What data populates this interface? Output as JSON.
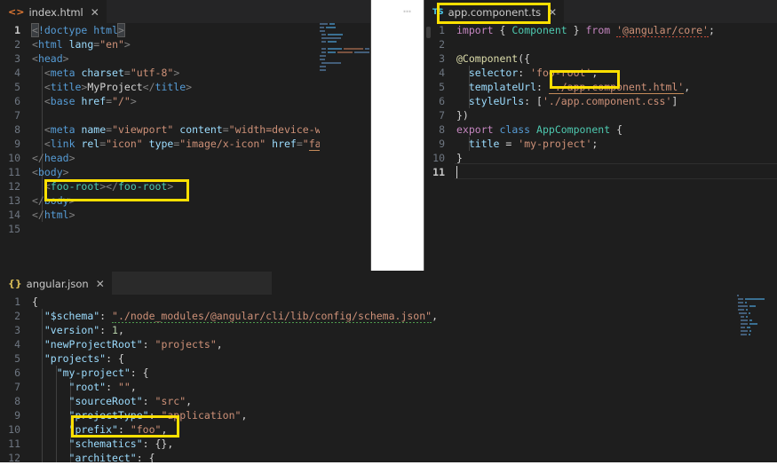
{
  "window": {
    "theme_bg": "#1e1e1e",
    "tabbar_bg": "#252526",
    "highlight_color": "#ffe000",
    "overflow_menu": "…"
  },
  "editors": [
    {
      "id": "left-editor",
      "tab": {
        "label": "index.html",
        "icon": "html-icon",
        "icon_glyph": "<>",
        "close_glyph": "✕",
        "icon_color": "#e37933"
      },
      "lines": [
        {
          "n": "1",
          "text": "<!doctype html>"
        },
        {
          "n": "2",
          "text": "<html lang=\"en\">"
        },
        {
          "n": "3",
          "text": "<head>"
        },
        {
          "n": "4",
          "text": "  <meta charset=\"utf-8\">"
        },
        {
          "n": "5",
          "text": "  <title>MyProject</title>"
        },
        {
          "n": "6",
          "text": "  <base href=\"/\">"
        },
        {
          "n": "7",
          "text": ""
        },
        {
          "n": "8",
          "text": "  <meta name=\"viewport\" content=\"width=device-width, initi"
        },
        {
          "n": "9",
          "text": "  <link rel=\"icon\" type=\"image/x-icon\" href=\"favicon.ico\">"
        },
        {
          "n": "10",
          "text": "</head>"
        },
        {
          "n": "11",
          "text": "<body>"
        },
        {
          "n": "12",
          "text": "  <foo-root></foo-root>"
        },
        {
          "n": "13",
          "text": "</body>"
        },
        {
          "n": "14",
          "text": "</html>"
        },
        {
          "n": "15",
          "text": ""
        }
      ],
      "highlighted_text": "<foo-root></foo-root>"
    },
    {
      "id": "right-editor",
      "tab": {
        "label": "app.component.ts",
        "icon": "typescript-icon",
        "icon_glyph": "TS",
        "close_glyph": "✕",
        "icon_color": "#4ec9e8"
      },
      "lines": [
        {
          "n": "1",
          "text": "import { Component } from '@angular/core';"
        },
        {
          "n": "2",
          "text": ""
        },
        {
          "n": "3",
          "text": "@Component({"
        },
        {
          "n": "4",
          "text": "  selector: 'foo-root',"
        },
        {
          "n": "5",
          "text": "  templateUrl: './app.component.html',"
        },
        {
          "n": "6",
          "text": "  styleUrls: ['./app.component.css']"
        },
        {
          "n": "7",
          "text": "})"
        },
        {
          "n": "8",
          "text": "export class AppComponent {"
        },
        {
          "n": "9",
          "text": "  title = 'my-project';"
        },
        {
          "n": "10",
          "text": "}"
        },
        {
          "n": "11",
          "text": ""
        }
      ],
      "highlighted_text": "'foo-root',",
      "highlighted_tab": "app.component.ts"
    },
    {
      "id": "bottom-editor",
      "tab": {
        "label": "angular.json",
        "icon": "json-icon",
        "icon_glyph": "{}",
        "close_glyph": "✕",
        "icon_color": "#d7ba55"
      },
      "lines": [
        {
          "n": "1",
          "text": "{"
        },
        {
          "n": "2",
          "text": "  \"$schema\": \"./node_modules/@angular/cli/lib/config/schema.json\","
        },
        {
          "n": "3",
          "text": "  \"version\": 1,"
        },
        {
          "n": "4",
          "text": "  \"newProjectRoot\": \"projects\","
        },
        {
          "n": "5",
          "text": "  \"projects\": {"
        },
        {
          "n": "6",
          "text": "    \"my-project\": {"
        },
        {
          "n": "7",
          "text": "      \"root\": \"\","
        },
        {
          "n": "8",
          "text": "      \"sourceRoot\": \"src\","
        },
        {
          "n": "9",
          "text": "      \"projectType\": \"application\","
        },
        {
          "n": "10",
          "text": "      \"prefix\": \"foo\","
        },
        {
          "n": "11",
          "text": "      \"schematics\": {},"
        },
        {
          "n": "12",
          "text": "      \"architect\": {"
        }
      ],
      "highlighted_text": "\"prefix\": \"foo\","
    }
  ]
}
